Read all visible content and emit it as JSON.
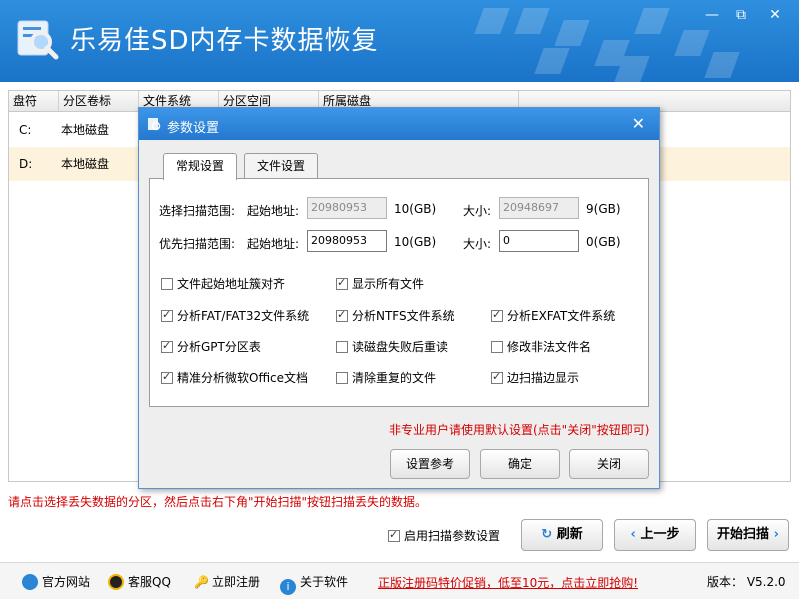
{
  "app": {
    "title": "乐易佳SD内存卡数据恢复"
  },
  "window": {
    "minimize": "—",
    "restore": "⧉",
    "close": "✕"
  },
  "table": {
    "headers": [
      "盘符",
      "分区卷标",
      "文件系统",
      "分区空间",
      "所属磁盘"
    ],
    "rows": [
      {
        "drive": "C:",
        "label": "本地磁盘"
      },
      {
        "drive": "D:",
        "label": "本地磁盘"
      }
    ]
  },
  "hint": "请点击选择丢失数据的分区，然后点击右下角\"开始扫描\"按钮扫描丢失的数据。",
  "bottom": {
    "scan_option": "启用扫描参数设置",
    "refresh": "刷新",
    "prev": "上一步",
    "start": "开始扫描"
  },
  "footer": {
    "site": "官方网站",
    "qq": "客服QQ",
    "register": "立即注册",
    "about": "关于软件",
    "promo": "正版注册码特价促销，低至10元，点击立即抢购!",
    "version": "版本： V5.2.0"
  },
  "dialog": {
    "title": "参数设置",
    "close": "✕",
    "tabs": [
      "常规设置",
      "文件设置"
    ],
    "scan_range": {
      "label": "选择扫描范围:",
      "start_label": "起始地址:",
      "start": "20980953",
      "unit1": "10(GB)",
      "size_label": "大小:",
      "size": "20948697",
      "unit2": "9(GB)"
    },
    "priority_range": {
      "label": "优先扫描范围:",
      "start_label": "起始地址:",
      "start": "20980953",
      "unit1": "10(GB)",
      "size_label": "大小:",
      "size": "0",
      "unit2": "0(GB)"
    },
    "options": [
      {
        "label": "文件起始地址簇对齐",
        "checked": false
      },
      {
        "label": "显示所有文件",
        "checked": true
      },
      {
        "label": "分析FAT/FAT32文件系统",
        "checked": true
      },
      {
        "label": "分析NTFS文件系统",
        "checked": true
      },
      {
        "label": "分析EXFAT文件系统",
        "checked": true
      },
      {
        "label": "分析GPT分区表",
        "checked": true
      },
      {
        "label": "读磁盘失败后重读",
        "checked": false
      },
      {
        "label": "修改非法文件名",
        "checked": false
      },
      {
        "label": "精准分析微软Office文档",
        "checked": true
      },
      {
        "label": "清除重复的文件",
        "checked": false
      },
      {
        "label": "边扫描边显示",
        "checked": true
      }
    ],
    "warning": "非专业用户请使用默认设置(点击\"关闭\"按钮即可)",
    "buttons": {
      "ref": "设置参考",
      "ok": "确定",
      "close": "关闭"
    }
  }
}
